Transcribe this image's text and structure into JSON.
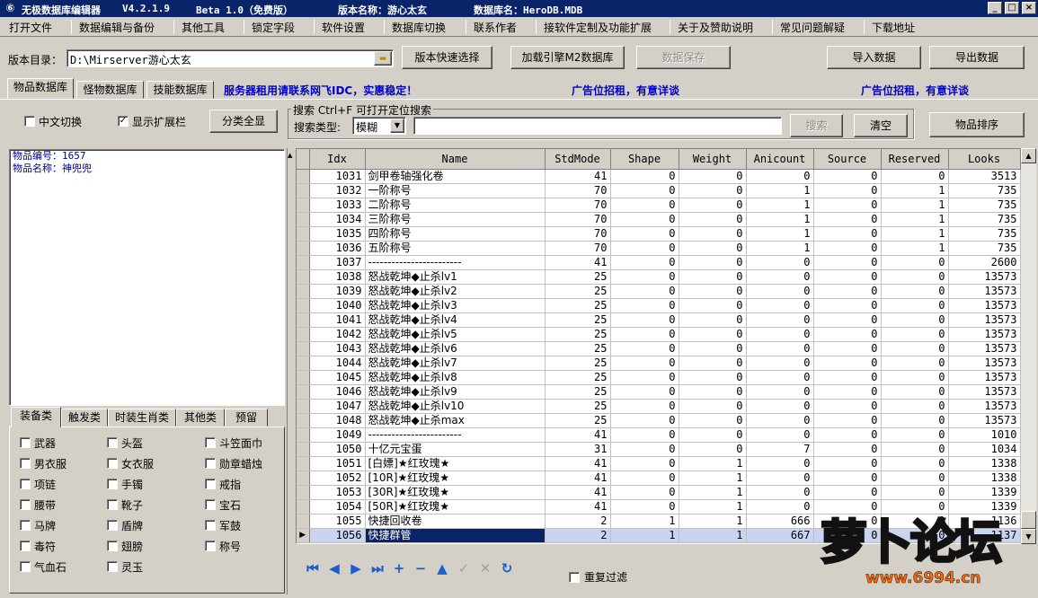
{
  "titlebar": {
    "app_name": "无极数据库编辑器",
    "version": "V4.2.1.9",
    "beta": "Beta 1.0（免费版）",
    "server_name": "版本名称：游心太玄",
    "db_name": "数据库名：HeroDB.MDB",
    "min": "_",
    "max": "□",
    "close": "×"
  },
  "menu": [
    "打开文件",
    "数据编辑与备份",
    "其他工具",
    "锁定字段",
    "软件设置",
    "数据库切换",
    "联系作者",
    "接软件定制及功能扩展",
    "关于及赞助说明",
    "常见问题解疑",
    "下载地址"
  ],
  "toolbar": {
    "dir_label": "版本目录：",
    "dir_value": "D:\\Mirserver游心太玄",
    "quick_select": "版本快速选择",
    "load_engine": "加载引擎M2数据库",
    "save_data": "数据保存",
    "import": "导入数据",
    "export": "导出数据"
  },
  "tabs": [
    "物品数据库",
    "怪物数据库",
    "技能数据库"
  ],
  "ads": [
    "服务器租用请联系网飞IDC，实惠稳定！",
    "广告位招租，有意详谈",
    "广告位招租，有意详谈"
  ],
  "options": {
    "chinese_switch": "中文切换",
    "show_ext": "显示扩展栏",
    "show_all": "分类全显",
    "chinese_checked": false,
    "ext_checked": true
  },
  "search": {
    "group_title": "搜索  Ctrl+F 可打开定位搜索",
    "type_label": "搜索类型:",
    "type_value": "模糊",
    "query": "",
    "search_btn": "搜索",
    "clear_btn": "清空",
    "sort_btn": "物品排序"
  },
  "item_info": [
    "物品编号：1657",
    "物品名称：神兜兜"
  ],
  "category_tabs": [
    "装备类",
    "触发类",
    "时装生肖类",
    "其他类",
    "预留"
  ],
  "categories": [
    [
      "武器",
      "头盔",
      "斗笠面巾"
    ],
    [
      "男衣服",
      "女衣服",
      "勋章蜡烛"
    ],
    [
      "项链",
      "手镯",
      "戒指"
    ],
    [
      "腰带",
      "靴子",
      "宝石"
    ],
    [
      "马牌",
      "盾牌",
      "军鼓"
    ],
    [
      "毒符",
      "翅膀",
      "称号"
    ],
    [
      "气血石",
      "灵玉",
      ""
    ]
  ],
  "grid": {
    "columns": [
      "Idx",
      "Name",
      "StdMode",
      "Shape",
      "Weight",
      "Anicount",
      "Source",
      "Reserved",
      "Looks"
    ],
    "rows": [
      [
        "1031",
        "剑甲卷轴强化卷",
        "41",
        "0",
        "0",
        "0",
        "0",
        "0",
        "3513"
      ],
      [
        "1032",
        "一阶称号",
        "70",
        "0",
        "0",
        "1",
        "0",
        "1",
        "735"
      ],
      [
        "1033",
        "二阶称号",
        "70",
        "0",
        "0",
        "1",
        "0",
        "1",
        "735"
      ],
      [
        "1034",
        "三阶称号",
        "70",
        "0",
        "0",
        "1",
        "0",
        "1",
        "735"
      ],
      [
        "1035",
        "四阶称号",
        "70",
        "0",
        "0",
        "1",
        "0",
        "1",
        "735"
      ],
      [
        "1036",
        "五阶称号",
        "70",
        "0",
        "0",
        "1",
        "0",
        "1",
        "735"
      ],
      [
        "1037",
        "------------------------",
        "41",
        "0",
        "0",
        "0",
        "0",
        "0",
        "2600"
      ],
      [
        "1038",
        "怒战乾坤◆止杀lv1",
        "25",
        "0",
        "0",
        "0",
        "0",
        "0",
        "13573"
      ],
      [
        "1039",
        "怒战乾坤◆止杀lv2",
        "25",
        "0",
        "0",
        "0",
        "0",
        "0",
        "13573"
      ],
      [
        "1040",
        "怒战乾坤◆止杀lv3",
        "25",
        "0",
        "0",
        "0",
        "0",
        "0",
        "13573"
      ],
      [
        "1041",
        "怒战乾坤◆止杀lv4",
        "25",
        "0",
        "0",
        "0",
        "0",
        "0",
        "13573"
      ],
      [
        "1042",
        "怒战乾坤◆止杀lv5",
        "25",
        "0",
        "0",
        "0",
        "0",
        "0",
        "13573"
      ],
      [
        "1043",
        "怒战乾坤◆止杀lv6",
        "25",
        "0",
        "0",
        "0",
        "0",
        "0",
        "13573"
      ],
      [
        "1044",
        "怒战乾坤◆止杀lv7",
        "25",
        "0",
        "0",
        "0",
        "0",
        "0",
        "13573"
      ],
      [
        "1045",
        "怒战乾坤◆止杀lv8",
        "25",
        "0",
        "0",
        "0",
        "0",
        "0",
        "13573"
      ],
      [
        "1046",
        "怒战乾坤◆止杀lv9",
        "25",
        "0",
        "0",
        "0",
        "0",
        "0",
        "13573"
      ],
      [
        "1047",
        "怒战乾坤◆止杀lv10",
        "25",
        "0",
        "0",
        "0",
        "0",
        "0",
        "13573"
      ],
      [
        "1048",
        "怒战乾坤◆止杀max",
        "25",
        "0",
        "0",
        "0",
        "0",
        "0",
        "13573"
      ],
      [
        "1049",
        "------------------------",
        "41",
        "0",
        "0",
        "0",
        "0",
        "0",
        "1010"
      ],
      [
        "1050",
        "十亿元宝蛋",
        "31",
        "0",
        "0",
        "7",
        "0",
        "0",
        "1034"
      ],
      [
        "1051",
        "[白嫖]★红玫瑰★",
        "41",
        "0",
        "1",
        "0",
        "0",
        "0",
        "1338"
      ],
      [
        "1052",
        "[10R]★红玫瑰★",
        "41",
        "0",
        "1",
        "0",
        "0",
        "0",
        "1338"
      ],
      [
        "1053",
        "[30R]★红玫瑰★",
        "41",
        "0",
        "1",
        "0",
        "0",
        "0",
        "1339"
      ],
      [
        "1054",
        "[50R]★红玫瑰★",
        "41",
        "0",
        "1",
        "0",
        "0",
        "0",
        "1339"
      ],
      [
        "1055",
        "快捷回收卷",
        "2",
        "1",
        "1",
        "666",
        "0",
        "0",
        "1136"
      ],
      [
        "1056",
        "快捷群管",
        "2",
        "1",
        "1",
        "667",
        "0",
        "0",
        "1137"
      ]
    ],
    "selected_index": 25
  },
  "nav": {
    "dedupe": "重复过滤",
    "dedupe_checked": false,
    "icons": [
      "first-icon",
      "prior-icon",
      "next-icon",
      "last-icon",
      "insert-icon",
      "delete-icon",
      "edit-icon",
      "post-icon",
      "cancel-icon",
      "refresh-icon"
    ]
  },
  "watermark": {
    "title": "萝卜论坛",
    "url": "www.6994.cn"
  }
}
